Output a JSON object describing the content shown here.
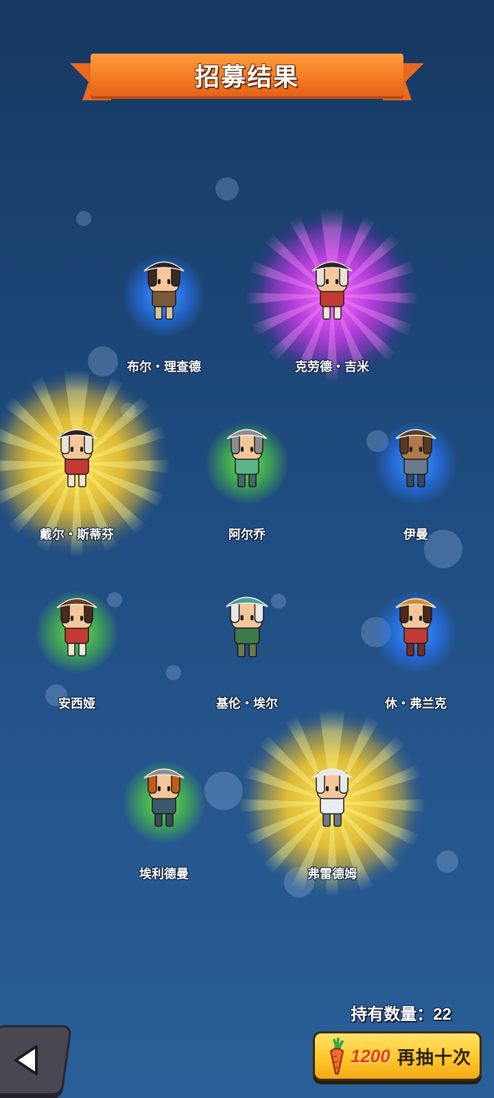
{
  "banner": {
    "title": "招募结果"
  },
  "heroes": [
    {
      "name": "布尔・理查德",
      "rarity": "blue",
      "colors": {
        "hat": "#2b2326",
        "coat": "#7a5a3a",
        "skin": "#f3c79a",
        "hair": "#3a2a20",
        "pants": "#d8c49a"
      }
    },
    {
      "name": "克劳德・吉米",
      "rarity": "purple",
      "colors": {
        "hat": "#2b2326",
        "coat": "#c23a34",
        "skin": "#f3c79a",
        "hair": "#e8e2d6",
        "pants": "#efe6d6"
      }
    },
    {
      "name": "戴尔・斯蒂芬",
      "rarity": "gold",
      "colors": {
        "hat": "#2b2326",
        "coat": "#c23a34",
        "skin": "#f3c79a",
        "hair": "#e8e2d6",
        "pants": "#efe6d6"
      }
    },
    {
      "name": "阿尔乔",
      "rarity": "green",
      "colors": {
        "hat": "#8a8c90",
        "coat": "#5bb58a",
        "skin": "#f3c79a",
        "hair": "#8a8c90",
        "pants": "#3f6a6a"
      }
    },
    {
      "name": "伊曼",
      "rarity": "blue",
      "colors": {
        "hat": "#5a3a22",
        "coat": "#6a7a8a",
        "skin": "#b07a4a",
        "hair": "#5a3a22",
        "pants": "#3a4a5a"
      }
    },
    {
      "name": "安西娅",
      "rarity": "green",
      "colors": {
        "hat": "#6a3a24",
        "coat": "#c23a34",
        "skin": "#f3c79a",
        "hair": "#4a2a1a",
        "pants": "#efe6d6"
      }
    },
    {
      "name": "基伦・埃尔",
      "rarity": "none",
      "colors": {
        "hat": "#4aa096",
        "coat": "#3f7a4a",
        "skin": "#f3c79a",
        "hair": "#e8e8e8",
        "pants": "#6a7a4a"
      }
    },
    {
      "name": "休・弗兰克",
      "rarity": "blue",
      "colors": {
        "hat": "#d88a2a",
        "coat": "#c23a34",
        "skin": "#f3c79a",
        "hair": "#4a2a1a",
        "pants": "#7a2a24"
      }
    },
    {
      "name": "埃利德曼",
      "rarity": "green",
      "colors": {
        "hat": "#8a8c90",
        "coat": "#3a5a6a",
        "skin": "#f3c79a",
        "hair": "#c45a1a",
        "pants": "#3a4a5a"
      }
    },
    {
      "name": "弗雷德姆",
      "rarity": "gold",
      "colors": {
        "hat": "#e8e8e8",
        "coat": "#eaeef2",
        "skin": "#f3c79a",
        "hair": "#e8e8e8",
        "pants": "#6a7a8a"
      }
    }
  ],
  "footer": {
    "owned_label": "持有数量：22",
    "draw_button": {
      "cost": "1200",
      "label": "再抽十次",
      "icon": "carrot-icon"
    },
    "back_button": {
      "icon": "back-arrow-icon"
    }
  }
}
